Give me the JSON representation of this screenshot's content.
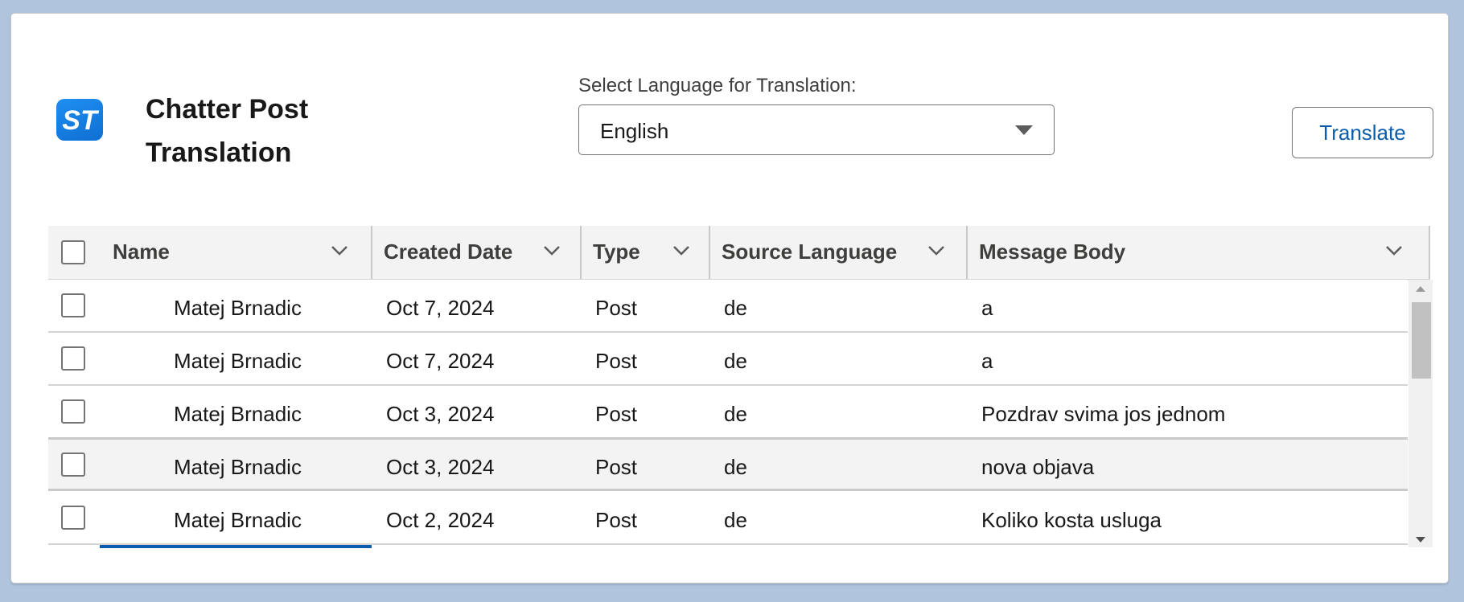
{
  "header": {
    "logo_text": "ST",
    "title_line1": "Chatter Post",
    "title_line2": "Translation"
  },
  "language": {
    "label": "Select Language for Translation:",
    "selected": "English"
  },
  "actions": {
    "translate_label": "Translate"
  },
  "table": {
    "columns": [
      "Name",
      "Created Date",
      "Type",
      "Source Language",
      "Message Body"
    ],
    "rows": [
      {
        "name": "Matej Brnadic",
        "date": "Oct 7, 2024",
        "type": "Post",
        "lang": "de",
        "body": "a"
      },
      {
        "name": "Matej Brnadic",
        "date": "Oct 7, 2024",
        "type": "Post",
        "lang": "de",
        "body": "a"
      },
      {
        "name": "Matej Brnadic",
        "date": "Oct 3, 2024",
        "type": "Post",
        "lang": "de",
        "body": "Pozdrav svima jos jednom"
      },
      {
        "name": "Matej Brnadic",
        "date": "Oct 3, 2024",
        "type": "Post",
        "lang": "de",
        "body": "nova objava"
      },
      {
        "name": "Matej Brnadic",
        "date": "Oct 2, 2024",
        "type": "Post",
        "lang": "de",
        "body": "Koliko kosta usluga"
      }
    ]
  },
  "colors": {
    "background": "#b0c4de",
    "brand": "#1589ee",
    "link": "#0b5cab"
  },
  "icons": [
    "st-logo-icon",
    "caret-down-icon",
    "chevron-down-icon",
    "scroll-up-icon",
    "scroll-down-icon"
  ]
}
